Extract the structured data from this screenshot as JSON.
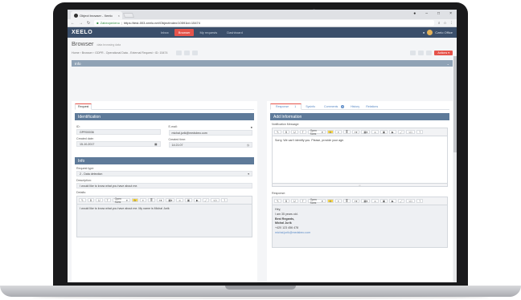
{
  "browser": {
    "tab_title": "Object browser - Xeelo",
    "secure_label": "Zabezpečeno",
    "url": "https://test-003.xeelo.net/ObjectIndex/10591id=15474"
  },
  "app": {
    "logo": "XEELO",
    "nav": [
      "Inbox",
      "Browser",
      "My requests",
      "Dashboard"
    ],
    "active_nav": "Browser",
    "user": "Czelo Office"
  },
  "page": {
    "title": "Browser",
    "subtitle": "data browsing data",
    "breadcrumb": "Home › Browser › GDPR - Operational Data - External Request › ID: 15474",
    "actions_label": "Actions ▾",
    "info_bar": "Info"
  },
  "left": {
    "tabs": [
      "Request"
    ],
    "identification": {
      "header": "Identification",
      "id_label": "ID:",
      "id_value": "GPR00036",
      "email_label": "E-mail:",
      "email_value": "michal.jurik@medsbeo.com",
      "created_date_label": "Created date:",
      "created_date_value": "15-10-2017",
      "created_time_label": "Created time:",
      "created_time_value": "14:21:07"
    },
    "info": {
      "header": "Info",
      "request_type_label": "Request type:",
      "request_type_value": "2 - Data detection",
      "description_label": "Description:",
      "description_value": "I would like to know what you have about me.",
      "details_label": "Details:",
      "details_value": "I would like to know what you have about me. My name is Michal Jurik"
    }
  },
  "right": {
    "tabs": [
      "Response",
      "Sysinfo",
      "Comments",
      "History",
      "Relations"
    ],
    "response_badge": "1",
    "comments_badge": "0",
    "add_info": {
      "header": "Add Information",
      "notification_label": "Notification Message:",
      "notification_value": "Sorry, We can't identify you. Please, provide your age.",
      "response_label": "Response:",
      "response_lines": [
        "Hey,",
        "I am 35 years old.",
        "Best Regards,",
        "Michal Jurik",
        "+420 123 456 478",
        "michal.jurik@medsbeo.com"
      ]
    }
  },
  "editor": {
    "font": "Open Sans"
  }
}
